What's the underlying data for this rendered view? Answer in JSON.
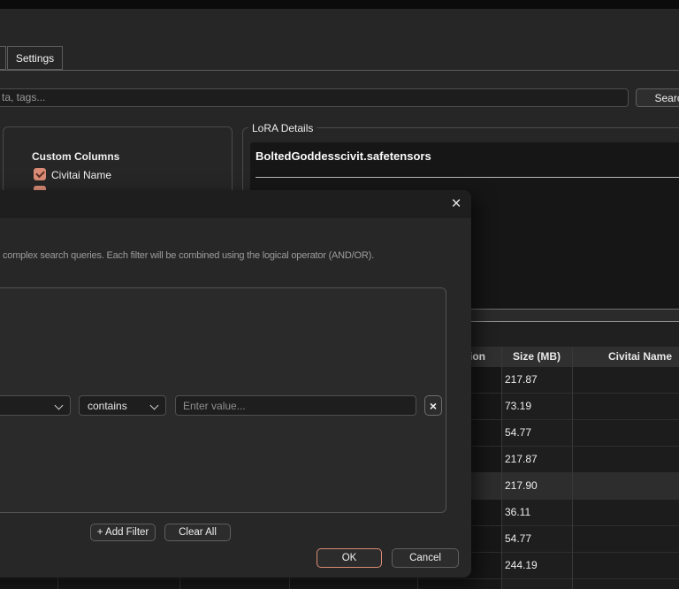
{
  "app": {
    "tab_settings": "Settings",
    "search_placeholder_fragment": "ta, tags...",
    "search_button": "Search"
  },
  "left_panel": {
    "title": "Custom Columns",
    "checkbox_civitai_name": "Civitai Name",
    "checkbox_checked": true
  },
  "lora_details": {
    "legend": "LoRA Details",
    "filename": "BoltedGoddesscivit.safetensors"
  },
  "filter_dialog": {
    "close_icon": "×",
    "description_fragment": "complex search queries. Each filter will be combined using the logical operator (AND/OR).",
    "filter_row": {
      "operator_selected": "contains",
      "value_placeholder": "Enter value...",
      "remove_icon": "×"
    },
    "add_filter_button": "+ Add Filter",
    "clear_all_button": "Clear All",
    "ok_button": "OK",
    "cancel_button": "Cancel"
  },
  "table": {
    "headers": {
      "version_fragment": "ion",
      "size": "Size (MB)",
      "civitai_name": "Civitai Name"
    },
    "size_values": [
      "217.87",
      "73.19",
      "54.77",
      "217.87",
      "217.90",
      "36.11",
      "54.77",
      "244.19"
    ],
    "highlighted_index": 4
  },
  "colors": {
    "accent": "#dd8b73",
    "window_bg": "#262626",
    "dialog_bg": "#272727",
    "table_header_bg": "#303030"
  }
}
